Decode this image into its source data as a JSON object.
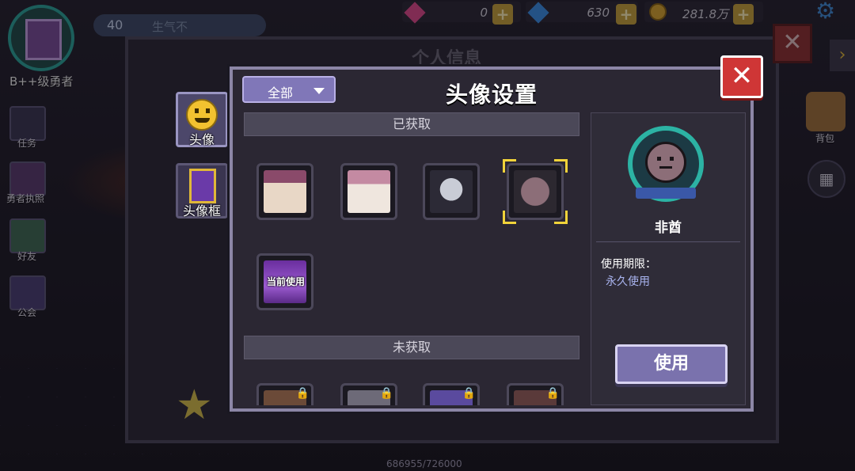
{
  "player": {
    "rank": "B++级勇者",
    "level": "40",
    "name": "生气不"
  },
  "currencies": [
    {
      "icon": "pink-gem-icon",
      "value": "0",
      "color": "#e04a8a"
    },
    {
      "icon": "blue-gem-icon",
      "value": "630",
      "color": "#3a8ee6"
    },
    {
      "icon": "gold-coin-icon",
      "value": "281.8万",
      "color": "#d9a62e"
    }
  ],
  "side_menu": [
    "任务",
    "勇者执照",
    "好友",
    "公会"
  ],
  "right_menu": {
    "bag": "背包"
  },
  "background": {
    "panel_title": "个人信息",
    "exp": "686955/726000"
  },
  "dialog": {
    "title": "头像设置",
    "filter": "全部",
    "tabs": [
      {
        "label": "头像"
      },
      {
        "label": "头像框"
      }
    ],
    "section_obtained": "已获取",
    "section_unobtained": "未获取",
    "current_tag": "当前使用",
    "obtained_items": [
      {
        "name": "hooded-girl-avatar",
        "palette": "#e8d7c6"
      },
      {
        "name": "pink-hat-girl-avatar",
        "palette": "#d9b9c4"
      },
      {
        "name": "silver-crest-avatar",
        "palette": "#8c8f9e"
      },
      {
        "name": "blob-avatar",
        "palette": "#7a6470",
        "selected": true
      },
      {
        "name": "purple-frame-avatar",
        "palette": "#9b5bd0",
        "current": true
      }
    ],
    "locked_items": [
      {
        "name": "locked-avatar-1",
        "palette": "#6b4a38"
      },
      {
        "name": "locked-avatar-2",
        "palette": "#6d6a78"
      },
      {
        "name": "locked-avatar-3",
        "palette": "#5a4a9e"
      },
      {
        "name": "locked-avatar-4",
        "palette": "#5a3a3a"
      }
    ],
    "detail": {
      "name": "非酋",
      "validity_label": "使用期限：",
      "validity_value": "永久使用",
      "use_button": "使用"
    }
  }
}
